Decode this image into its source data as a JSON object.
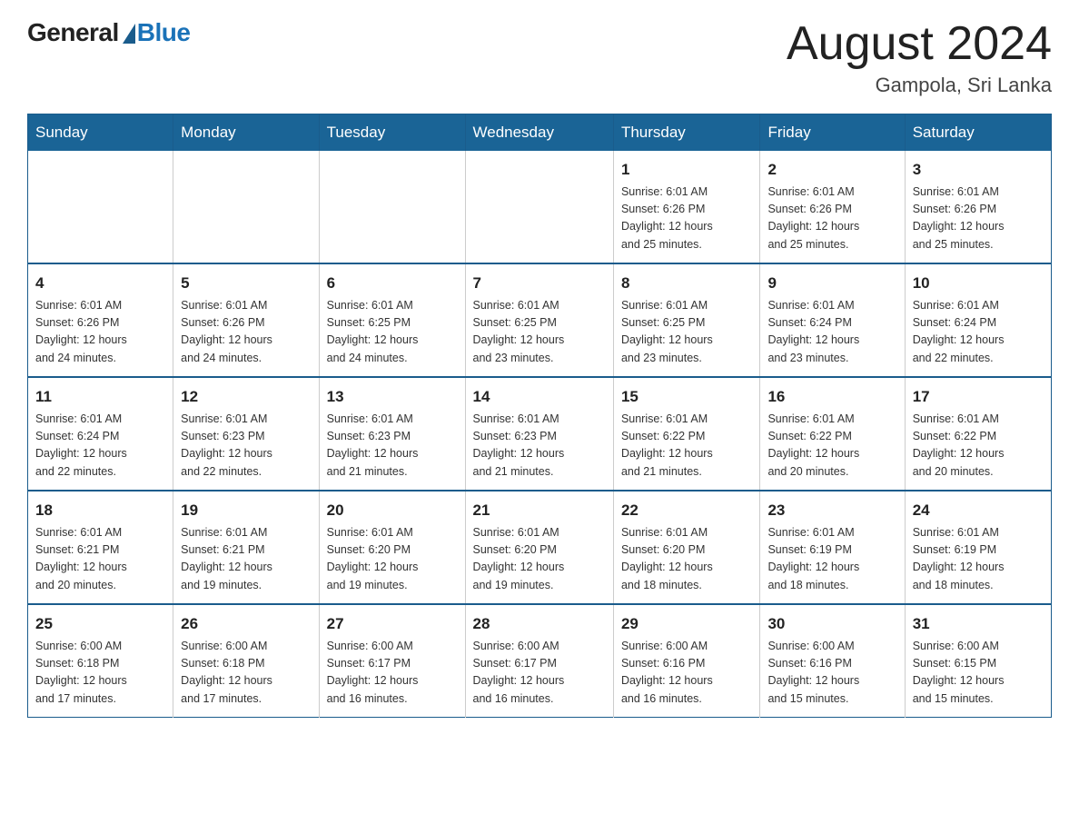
{
  "header": {
    "logo_general": "General",
    "logo_blue": "Blue",
    "month_year": "August 2024",
    "location": "Gampola, Sri Lanka"
  },
  "days_of_week": [
    "Sunday",
    "Monday",
    "Tuesday",
    "Wednesday",
    "Thursday",
    "Friday",
    "Saturday"
  ],
  "weeks": [
    {
      "days": [
        {
          "num": "",
          "info": ""
        },
        {
          "num": "",
          "info": ""
        },
        {
          "num": "",
          "info": ""
        },
        {
          "num": "",
          "info": ""
        },
        {
          "num": "1",
          "info": "Sunrise: 6:01 AM\nSunset: 6:26 PM\nDaylight: 12 hours\nand 25 minutes."
        },
        {
          "num": "2",
          "info": "Sunrise: 6:01 AM\nSunset: 6:26 PM\nDaylight: 12 hours\nand 25 minutes."
        },
        {
          "num": "3",
          "info": "Sunrise: 6:01 AM\nSunset: 6:26 PM\nDaylight: 12 hours\nand 25 minutes."
        }
      ]
    },
    {
      "days": [
        {
          "num": "4",
          "info": "Sunrise: 6:01 AM\nSunset: 6:26 PM\nDaylight: 12 hours\nand 24 minutes."
        },
        {
          "num": "5",
          "info": "Sunrise: 6:01 AM\nSunset: 6:26 PM\nDaylight: 12 hours\nand 24 minutes."
        },
        {
          "num": "6",
          "info": "Sunrise: 6:01 AM\nSunset: 6:25 PM\nDaylight: 12 hours\nand 24 minutes."
        },
        {
          "num": "7",
          "info": "Sunrise: 6:01 AM\nSunset: 6:25 PM\nDaylight: 12 hours\nand 23 minutes."
        },
        {
          "num": "8",
          "info": "Sunrise: 6:01 AM\nSunset: 6:25 PM\nDaylight: 12 hours\nand 23 minutes."
        },
        {
          "num": "9",
          "info": "Sunrise: 6:01 AM\nSunset: 6:24 PM\nDaylight: 12 hours\nand 23 minutes."
        },
        {
          "num": "10",
          "info": "Sunrise: 6:01 AM\nSunset: 6:24 PM\nDaylight: 12 hours\nand 22 minutes."
        }
      ]
    },
    {
      "days": [
        {
          "num": "11",
          "info": "Sunrise: 6:01 AM\nSunset: 6:24 PM\nDaylight: 12 hours\nand 22 minutes."
        },
        {
          "num": "12",
          "info": "Sunrise: 6:01 AM\nSunset: 6:23 PM\nDaylight: 12 hours\nand 22 minutes."
        },
        {
          "num": "13",
          "info": "Sunrise: 6:01 AM\nSunset: 6:23 PM\nDaylight: 12 hours\nand 21 minutes."
        },
        {
          "num": "14",
          "info": "Sunrise: 6:01 AM\nSunset: 6:23 PM\nDaylight: 12 hours\nand 21 minutes."
        },
        {
          "num": "15",
          "info": "Sunrise: 6:01 AM\nSunset: 6:22 PM\nDaylight: 12 hours\nand 21 minutes."
        },
        {
          "num": "16",
          "info": "Sunrise: 6:01 AM\nSunset: 6:22 PM\nDaylight: 12 hours\nand 20 minutes."
        },
        {
          "num": "17",
          "info": "Sunrise: 6:01 AM\nSunset: 6:22 PM\nDaylight: 12 hours\nand 20 minutes."
        }
      ]
    },
    {
      "days": [
        {
          "num": "18",
          "info": "Sunrise: 6:01 AM\nSunset: 6:21 PM\nDaylight: 12 hours\nand 20 minutes."
        },
        {
          "num": "19",
          "info": "Sunrise: 6:01 AM\nSunset: 6:21 PM\nDaylight: 12 hours\nand 19 minutes."
        },
        {
          "num": "20",
          "info": "Sunrise: 6:01 AM\nSunset: 6:20 PM\nDaylight: 12 hours\nand 19 minutes."
        },
        {
          "num": "21",
          "info": "Sunrise: 6:01 AM\nSunset: 6:20 PM\nDaylight: 12 hours\nand 19 minutes."
        },
        {
          "num": "22",
          "info": "Sunrise: 6:01 AM\nSunset: 6:20 PM\nDaylight: 12 hours\nand 18 minutes."
        },
        {
          "num": "23",
          "info": "Sunrise: 6:01 AM\nSunset: 6:19 PM\nDaylight: 12 hours\nand 18 minutes."
        },
        {
          "num": "24",
          "info": "Sunrise: 6:01 AM\nSunset: 6:19 PM\nDaylight: 12 hours\nand 18 minutes."
        }
      ]
    },
    {
      "days": [
        {
          "num": "25",
          "info": "Sunrise: 6:00 AM\nSunset: 6:18 PM\nDaylight: 12 hours\nand 17 minutes."
        },
        {
          "num": "26",
          "info": "Sunrise: 6:00 AM\nSunset: 6:18 PM\nDaylight: 12 hours\nand 17 minutes."
        },
        {
          "num": "27",
          "info": "Sunrise: 6:00 AM\nSunset: 6:17 PM\nDaylight: 12 hours\nand 16 minutes."
        },
        {
          "num": "28",
          "info": "Sunrise: 6:00 AM\nSunset: 6:17 PM\nDaylight: 12 hours\nand 16 minutes."
        },
        {
          "num": "29",
          "info": "Sunrise: 6:00 AM\nSunset: 6:16 PM\nDaylight: 12 hours\nand 16 minutes."
        },
        {
          "num": "30",
          "info": "Sunrise: 6:00 AM\nSunset: 6:16 PM\nDaylight: 12 hours\nand 15 minutes."
        },
        {
          "num": "31",
          "info": "Sunrise: 6:00 AM\nSunset: 6:15 PM\nDaylight: 12 hours\nand 15 minutes."
        }
      ]
    }
  ]
}
